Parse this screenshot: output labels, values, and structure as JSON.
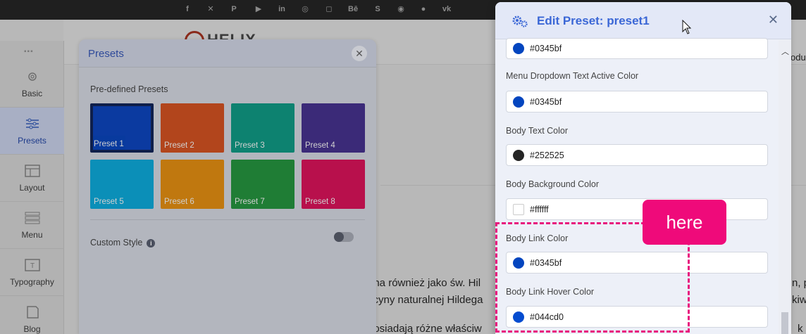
{
  "social_icons": [
    "facebook-icon",
    "x-icon",
    "pinterest-icon",
    "youtube-icon",
    "linkedin-icon",
    "dribbble-icon",
    "instagram-icon",
    "behance-icon",
    "skype-icon",
    "whatsapp-icon",
    "flickr-icon",
    "vk-icon"
  ],
  "site": {
    "logo_text": "HELIX",
    "fragments": [
      "ana również jako św. Hil",
      "ycyny naturalnej Hildega",
      "posiadają różne właściw",
      "oduc",
      "n, p",
      "kiwo",
      "k b"
    ]
  },
  "sidebar": {
    "items": [
      {
        "label": "Basic",
        "icon": "gear-icon"
      },
      {
        "label": "Presets",
        "icon": "sliders-icon"
      },
      {
        "label": "Layout",
        "icon": "layout-icon"
      },
      {
        "label": "Menu",
        "icon": "menu-icon"
      },
      {
        "label": "Typography",
        "icon": "typography-icon"
      },
      {
        "label": "Blog",
        "icon": "blog-icon"
      }
    ],
    "active": "Presets"
  },
  "presets_panel": {
    "title": "Presets",
    "predefined_label": "Pre-defined Presets",
    "presets": [
      {
        "label": "Preset 1",
        "color": "#0b3aa0",
        "selected": true
      },
      {
        "label": "Preset 2",
        "color": "#b2451c"
      },
      {
        "label": "Preset 3",
        "color": "#0d8270"
      },
      {
        "label": "Preset 4",
        "color": "#3b2a78"
      },
      {
        "label": "Preset 5",
        "color": "#0b8fb8"
      },
      {
        "label": "Preset 6",
        "color": "#c0780f"
      },
      {
        "label": "Preset 7",
        "color": "#1f7d35"
      },
      {
        "label": "Preset 8",
        "color": "#b8104c"
      }
    ],
    "custom_style_label": "Custom Style",
    "custom_style_enabled": false
  },
  "edit_panel": {
    "title": "Edit Preset: preset1",
    "fields": [
      {
        "label": "",
        "value": "#0345bf",
        "color": "#0345bf"
      },
      {
        "label": "Menu Dropdown Text Active Color",
        "value": "#0345bf",
        "color": "#0345bf"
      },
      {
        "label": "Body Text Color",
        "value": "#252525",
        "color": "#252525"
      },
      {
        "label": "Body Background Color",
        "value": "#ffffff",
        "color": "#ffffff"
      },
      {
        "label": "Body Link Color",
        "value": "#0345bf",
        "color": "#0345bf"
      },
      {
        "label": "Body Link Hover Color",
        "value": "#044cd0",
        "color": "#044cd0"
      }
    ]
  },
  "annotation": {
    "badge_text": "here",
    "color": "#ef0a7a"
  }
}
